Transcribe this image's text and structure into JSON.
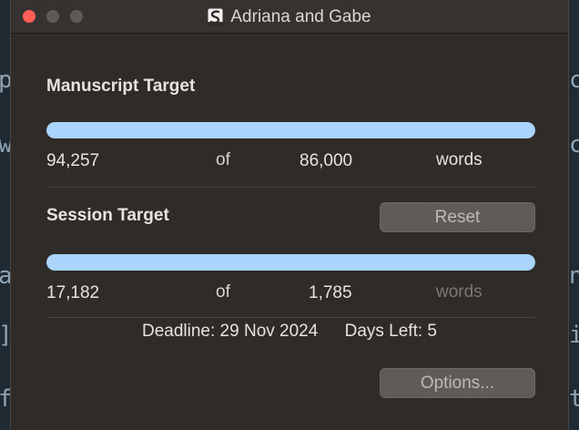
{
  "window": {
    "title": "Adriana and Gabe"
  },
  "background_chars": {
    "left": [
      "p",
      "w",
      "a",
      "]",
      "f"
    ],
    "right": [
      "c",
      "c",
      "n",
      "i",
      "t"
    ]
  },
  "manuscript": {
    "title": "Manuscript Target",
    "progress": 1.0,
    "current": "94,257",
    "of": "of",
    "target": "86,000",
    "unit": "words"
  },
  "session": {
    "title": "Session Target",
    "reset_label": "Reset",
    "progress": 1.0,
    "current": "17,182",
    "of": "of",
    "target": "1,785",
    "unit": "words"
  },
  "deadline": {
    "deadline_text": "Deadline: 29 Nov 2024",
    "days_left_text": "Days Left: 5"
  },
  "options_label": "Options...",
  "colors": {
    "bar_fill": "#aad4fb",
    "close": "#ff5f57",
    "muted_text": "#7b7874"
  }
}
